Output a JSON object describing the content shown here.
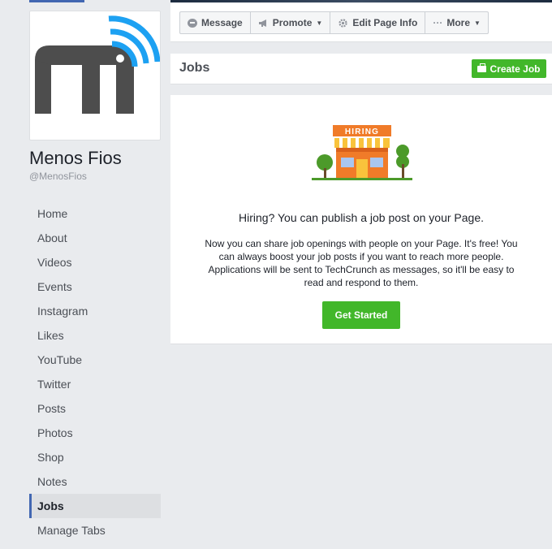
{
  "page": {
    "name": "Menos Fios",
    "handle": "@MenosFios"
  },
  "sidebar": {
    "items": [
      {
        "label": "Home"
      },
      {
        "label": "About"
      },
      {
        "label": "Videos"
      },
      {
        "label": "Events"
      },
      {
        "label": "Instagram"
      },
      {
        "label": "Likes"
      },
      {
        "label": "YouTube"
      },
      {
        "label": "Twitter"
      },
      {
        "label": "Posts"
      },
      {
        "label": "Photos"
      },
      {
        "label": "Shop"
      },
      {
        "label": "Notes"
      },
      {
        "label": "Jobs",
        "active": true
      },
      {
        "label": "Manage Tabs"
      }
    ]
  },
  "actions": {
    "message": "Message",
    "promote": "Promote",
    "edit_page_info": "Edit Page Info",
    "more": "More",
    "more_icon": "···"
  },
  "jobs": {
    "title": "Jobs",
    "create_job": "Create Job",
    "illustration_sign": "HIRING",
    "headline": "Hiring? You can publish a job post on your Page.",
    "description": "Now you can share job openings with people on your Page. It's free! You can always boost your job posts if you want to reach more people. Applications will be sent to TechCrunch as messages, so it'll be easy to read and respond to them.",
    "get_started": "Get Started"
  },
  "colors": {
    "accent_green": "#42b72a",
    "nav_active_border": "#4267b2",
    "background": "#e9ebee",
    "logo_blue": "#1da1f2",
    "logo_gray": "#4d4d4d"
  }
}
